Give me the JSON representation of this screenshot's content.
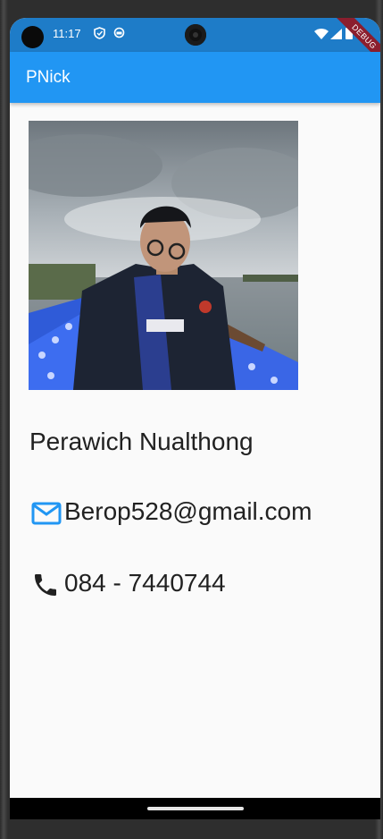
{
  "status_bar": {
    "time": "11:17",
    "icons": [
      "shield-icon",
      "sync-icon",
      "wifi-icon",
      "signal-icon",
      "battery-icon"
    ],
    "debug_banner": "DEBUG"
  },
  "app_bar": {
    "title": "PNick",
    "color": "#2196f3"
  },
  "profile": {
    "photo_alt": "profile-photo",
    "name": "Perawich Nualthong",
    "email": "Berop528@gmail.com",
    "phone": "084 - 7440744"
  },
  "colors": {
    "accent": "#2196f3",
    "email_icon": "#2196f3",
    "phone_icon": "#212121",
    "text": "#212121"
  }
}
